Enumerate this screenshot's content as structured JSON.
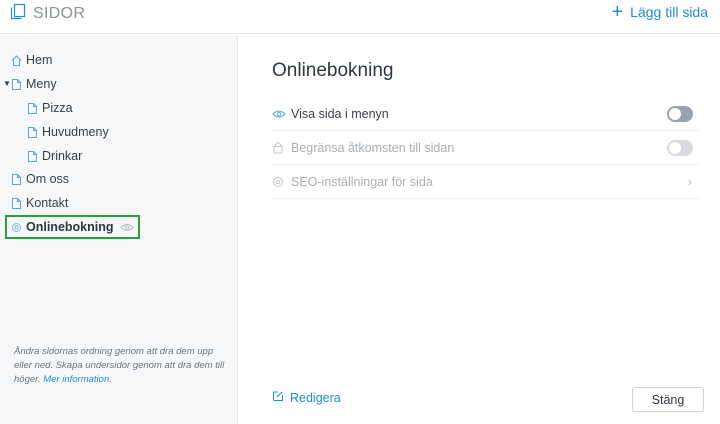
{
  "header": {
    "title": "SIDOR",
    "add_page_label": "Lägg till sida",
    "icons": {
      "pages": "pages-icon",
      "add": "plus-icon"
    }
  },
  "sidebar": {
    "items": [
      {
        "label": "Hem",
        "icon": "home-icon",
        "level": 0
      },
      {
        "label": "Meny",
        "icon": "page-icon",
        "level": 0,
        "expanded": true
      },
      {
        "label": "Pizza",
        "icon": "page-icon",
        "level": 1
      },
      {
        "label": "Huvudmeny",
        "icon": "page-icon",
        "level": 1
      },
      {
        "label": "Drinkar",
        "icon": "page-icon",
        "level": 1
      },
      {
        "label": "Om oss",
        "icon": "page-icon",
        "level": 0
      },
      {
        "label": "Kontakt",
        "icon": "page-icon",
        "level": 0
      },
      {
        "label": "Onlinebokning",
        "icon": "gear-icon",
        "level": 0,
        "active": true
      }
    ],
    "help_text": "Ändra sidornas ordning genom att dra dem upp eller ned. Skapa undersidor genom att dra dem till höger.",
    "help_link": "Mer information",
    "help_end": "."
  },
  "main": {
    "title": "Onlinebokning",
    "settings": [
      {
        "label": "Visa sida i menyn",
        "icon": "eye-icon",
        "control": "toggle",
        "on": true,
        "enabled": true
      },
      {
        "label": "Begränsa åtkomsten till sidan",
        "icon": "lock-icon",
        "control": "toggle",
        "on": false,
        "enabled": false
      },
      {
        "label": "SEO-inställningar för sida",
        "icon": "gear-icon",
        "control": "chevron",
        "enabled": false
      }
    ],
    "edit_label": "Redigera",
    "close_label": "Stäng"
  },
  "colors": {
    "accent": "#1f8dd6",
    "highlight_border": "#2e9e3a",
    "sidebar_bg": "#f6f7f8"
  }
}
